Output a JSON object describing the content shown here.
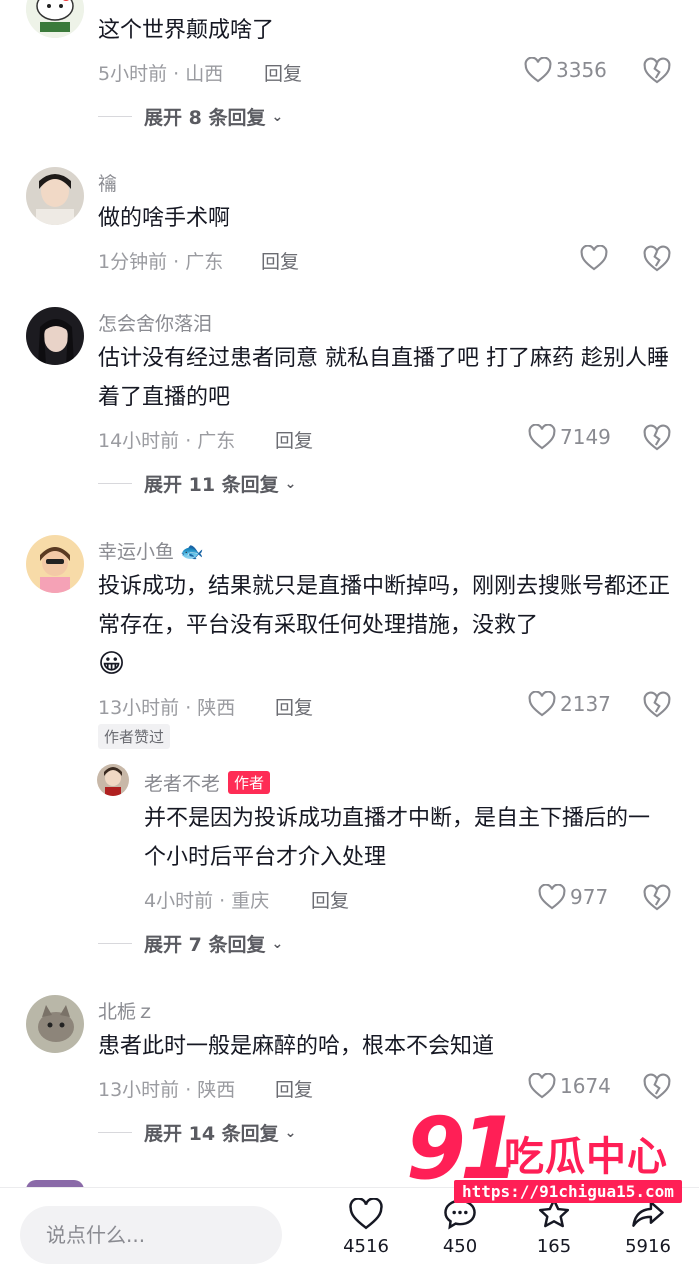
{
  "comments": [
    {
      "text": "这个世界颠成啥了",
      "time_location": "5小时前 · 山西",
      "reply_label": "回复",
      "likes": "3356",
      "expand": "展开 8 条回复"
    },
    {
      "username": "禴",
      "text": "做的啥手术啊",
      "time_location": "1分钟前 · 广东",
      "reply_label": "回复",
      "likes": ""
    },
    {
      "username": "怎会舍你落泪",
      "text": "估计没有经过患者同意 就私自直播了吧 打了麻药 趁别人睡着了直播的吧",
      "time_location": "14小时前 · 广东",
      "reply_label": "回复",
      "likes": "7149",
      "expand": "展开 11 条回复"
    },
    {
      "username": "幸运小鱼",
      "username_emoji": "🐟",
      "text": "投诉成功，结果就只是直播中断掉吗，刚刚去搜账号都还正常存在，平台没有采取任何处理措施，没救了",
      "text_emoji": "😀",
      "time_location": "13小时前 · 陕西",
      "reply_label": "回复",
      "likes": "2137",
      "badge": "作者赞过",
      "reply": {
        "username": "老者不老",
        "author_tag": "作者",
        "text": "并不是因为投诉成功直播才中断，是自主下播后的一个小时后平台才介入处理",
        "time_location": "4小时前 · 重庆",
        "reply_label": "回复",
        "likes": "977"
      },
      "expand": "展开 7 条回复"
    },
    {
      "username": "北栀ｚ",
      "text": "患者此时一般是麻醉的哈，根本不会知道",
      "time_location": "13小时前 · 陕西",
      "reply_label": "回复",
      "likes": "1674",
      "expand": "展开 14 条回复"
    }
  ],
  "bottom_bar": {
    "input_placeholder": "说点什么...",
    "like_count": "4516",
    "comment_count": "450",
    "favorite_count": "165",
    "share_count": "5916"
  },
  "watermark": {
    "number": "91",
    "name": "吃瓜中心",
    "url": "https://91chigua15.com"
  },
  "colors": {
    "accent": "#fe2c55",
    "muted": "#8a8b91"
  }
}
